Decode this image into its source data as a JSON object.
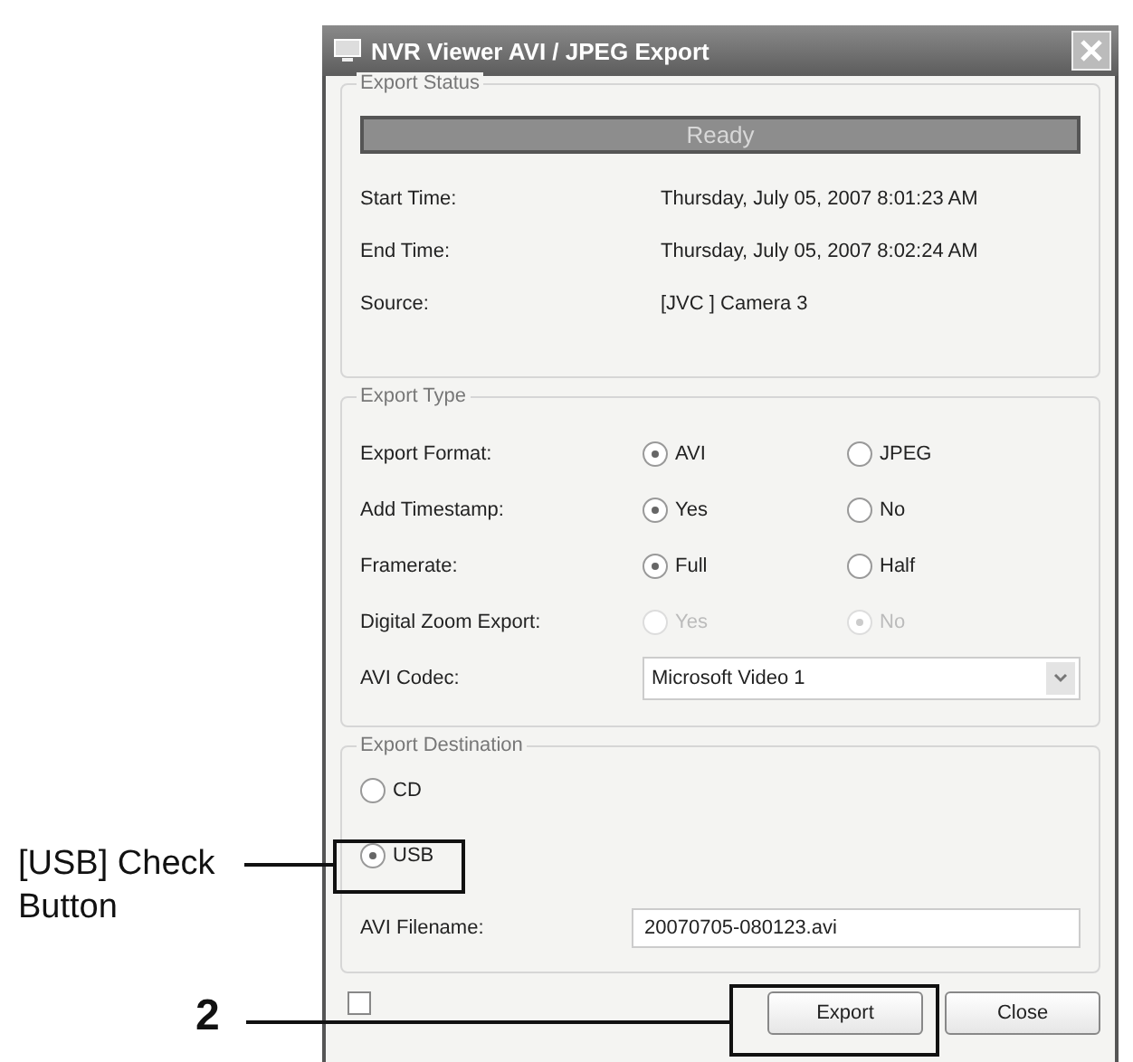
{
  "window": {
    "title": "NVR Viewer AVI / JPEG Export"
  },
  "export_status": {
    "legend": "Export Status",
    "status": "Ready",
    "rows": [
      {
        "label": "Start Time:",
        "value": "Thursday, July 05, 2007 8:01:23 AM"
      },
      {
        "label": "End Time:",
        "value": "Thursday, July 05, 2007 8:02:24 AM"
      },
      {
        "label": "Source:",
        "value": "[JVC ] Camera 3"
      }
    ]
  },
  "export_type": {
    "legend": "Export Type",
    "options": [
      {
        "label": "Export Format:",
        "choices": [
          {
            "label": "AVI",
            "selected": true,
            "disabled": false
          },
          {
            "label": "JPEG",
            "selected": false,
            "disabled": false
          }
        ]
      },
      {
        "label": "Add Timestamp:",
        "choices": [
          {
            "label": "Yes",
            "selected": true,
            "disabled": false
          },
          {
            "label": "No",
            "selected": false,
            "disabled": false
          }
        ]
      },
      {
        "label": "Framerate:",
        "choices": [
          {
            "label": "Full",
            "selected": true,
            "disabled": false
          },
          {
            "label": "Half",
            "selected": false,
            "disabled": false
          }
        ]
      },
      {
        "label": "Digital Zoom Export:",
        "choices": [
          {
            "label": "Yes",
            "selected": false,
            "disabled": true
          },
          {
            "label": "No",
            "selected": true,
            "disabled": true
          }
        ]
      }
    ],
    "codec": {
      "label": "AVI Codec:",
      "value": "Microsoft Video 1"
    }
  },
  "export_destination": {
    "legend": "Export Destination",
    "choices": [
      {
        "label": "CD",
        "selected": false
      },
      {
        "label": "USB",
        "selected": true
      }
    ],
    "filename": {
      "label": "AVI Filename:",
      "value": "20070705-080123.avi"
    }
  },
  "close_on_completion": {
    "checked": false
  },
  "buttons": [
    {
      "label": "Export"
    },
    {
      "label": "Close"
    }
  ],
  "annotations": [
    {
      "kind": "usb",
      "text": "[USB] Check Button"
    },
    {
      "kind": "export",
      "text": "2"
    }
  ]
}
